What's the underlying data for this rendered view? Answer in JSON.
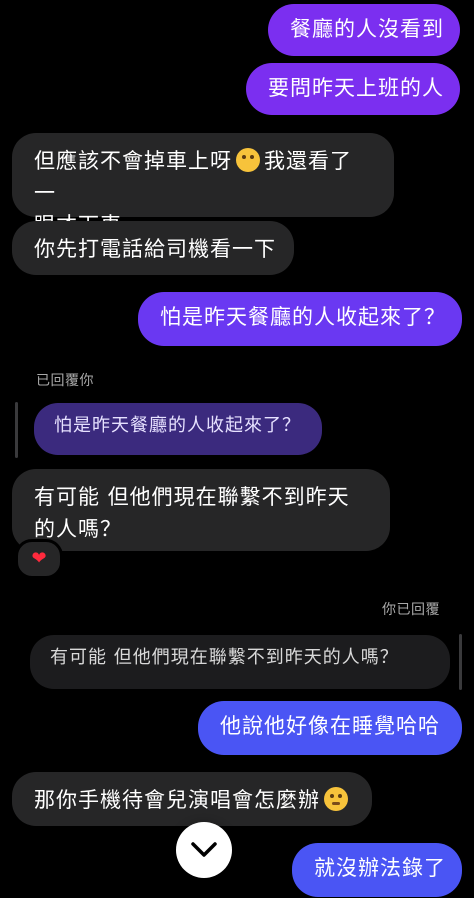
{
  "messages": [
    {
      "text": "餐廳的人沒看到"
    },
    {
      "text": "要問昨天上班的人"
    },
    {
      "text_a": "但應該不會掉車上呀",
      "text_b": "我還看了一",
      "text_c": "眼才下車",
      "emoji": "thinking-face"
    },
    {
      "text": "你先打電話給司機看一下"
    },
    {
      "text": "怕是昨天餐廳的人收起來了？"
    },
    {
      "text": "有可能 但他們現在聯繫不到昨天的人嗎？"
    },
    {
      "text": "他說他好像在睡覺哈哈"
    },
    {
      "text": "那你手機待會兒演唱會怎麼辦",
      "emoji": "pleading-face"
    },
    {
      "text": "就沒辦法錄了"
    }
  ],
  "replies": {
    "replied_to_you": "已回覆你",
    "quoted_1": "怕是昨天餐廳的人收起來了？",
    "you_replied": "你已回覆",
    "quoted_2": "有可能 但他們現在聯繫不到昨天的人嗎？"
  },
  "reaction": {
    "emoji": "❤",
    "name": "heart"
  },
  "colors": {
    "background": "#000000",
    "incoming_bubble": "#262627",
    "outgoing_purple": "#7b2ff0",
    "outgoing_indigo": "#6a38f2",
    "outgoing_blue": "#4a55f4",
    "reply_bubble": "#3b2a7e"
  }
}
